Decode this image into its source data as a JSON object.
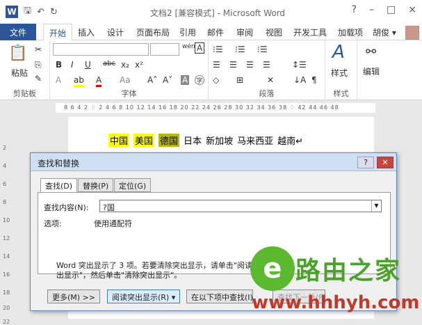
{
  "window": {
    "title": "文档2 [兼容模式] - Microsoft Word",
    "help": "?",
    "min": "–",
    "max": "□",
    "close": "×"
  },
  "qat": {
    "logo": "W",
    "save": "🖫",
    "undo": "↶",
    "redo": "↻"
  },
  "tabs": [
    "文件",
    "开始",
    "插入",
    "设计",
    "页面布局",
    "引用",
    "邮件",
    "审阅",
    "视图",
    "开发工具",
    "加载项",
    "胡俊 ▾"
  ],
  "ribbon": {
    "clipboard": {
      "label": "剪贴板",
      "paste": "粘贴"
    },
    "font": {
      "label": "字体",
      "bold": "B",
      "italic": "I",
      "underline": "U",
      "strike": "abc",
      "sub": "x₂",
      "sup": "x²",
      "wen": "wén",
      "A": "A"
    },
    "paragraph": {
      "label": "段落"
    },
    "styles": {
      "label": "样式",
      "button": "样式"
    },
    "editing": {
      "button": "编辑"
    }
  },
  "ruler": "8  6  4  2  ♢  2  4  6  8  10  12  14  16  18  20  22  24  26  28  30  32  34  36  38 ♢  42  44  46  48",
  "vruler": [
    "2",
    "4",
    "6",
    "8",
    "10",
    "12",
    "14",
    "16",
    "18",
    "20",
    "22"
  ],
  "document": {
    "words": [
      {
        "text": "中国",
        "hl": "yellow"
      },
      {
        "text": "美国",
        "hl": "yellow"
      },
      {
        "text": "德国",
        "hl": "dark"
      },
      {
        "text": "日本",
        "hl": "none"
      },
      {
        "text": "新加坡",
        "hl": "none"
      },
      {
        "text": "马来西亚",
        "hl": "none"
      },
      {
        "text": "越南↵",
        "hl": "none"
      }
    ]
  },
  "dialog": {
    "title": "查找和替换",
    "help": "?",
    "close": "✕",
    "tabs": [
      "查找(D)",
      "替换(P)",
      "定位(G)"
    ],
    "find_label": "查找内容(N):",
    "find_value": "?国",
    "options_label": "选项:",
    "options_value": "使用通配符",
    "message": "Word 突出显示了 3 项。若要清除突出显示，请单击\"阅读突出显示\"，然后单击\"清除突出显示\"。",
    "buttons": {
      "more": "更多(M) >>",
      "reading_highlight": "阅读突出显示(R) ▾",
      "find_in": "在以下项中查找(I) ▾",
      "find_next": "查找下一处(F)"
    }
  },
  "watermark": {
    "icon": "e",
    "text": "路由之家",
    "url": "www.hhhyh.com"
  }
}
